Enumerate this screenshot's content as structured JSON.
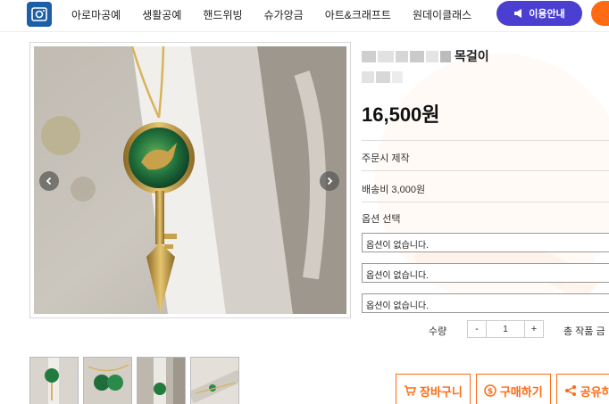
{
  "header": {
    "nav": [
      "아로마공예",
      "생활공예",
      "핸드위빙",
      "슈가앙금",
      "아트&크래프트",
      "원데이클래스"
    ],
    "guide_button": "이용안내"
  },
  "product": {
    "title_suffix": "목걸이",
    "price": "16,500원",
    "made_to_order": "주문시 제작",
    "shipping": "배송비 3,000원",
    "option_label": "옵션 선택",
    "options": [
      "옵션이 없습니다.",
      "옵션이 없습니다.",
      "옵션이 없습니다."
    ],
    "quantity_label": "수량",
    "quantity_minus": "-",
    "quantity_value": "1",
    "quantity_plus": "+",
    "total_label": "총 작품 금"
  },
  "actions": {
    "cart": "장바구니",
    "buy": "구매하기",
    "share": "공유하"
  },
  "colors": {
    "brand_purple": "#4b3fd1",
    "brand_orange": "#ff6a13",
    "logo_blue": "#1d5fa6"
  }
}
